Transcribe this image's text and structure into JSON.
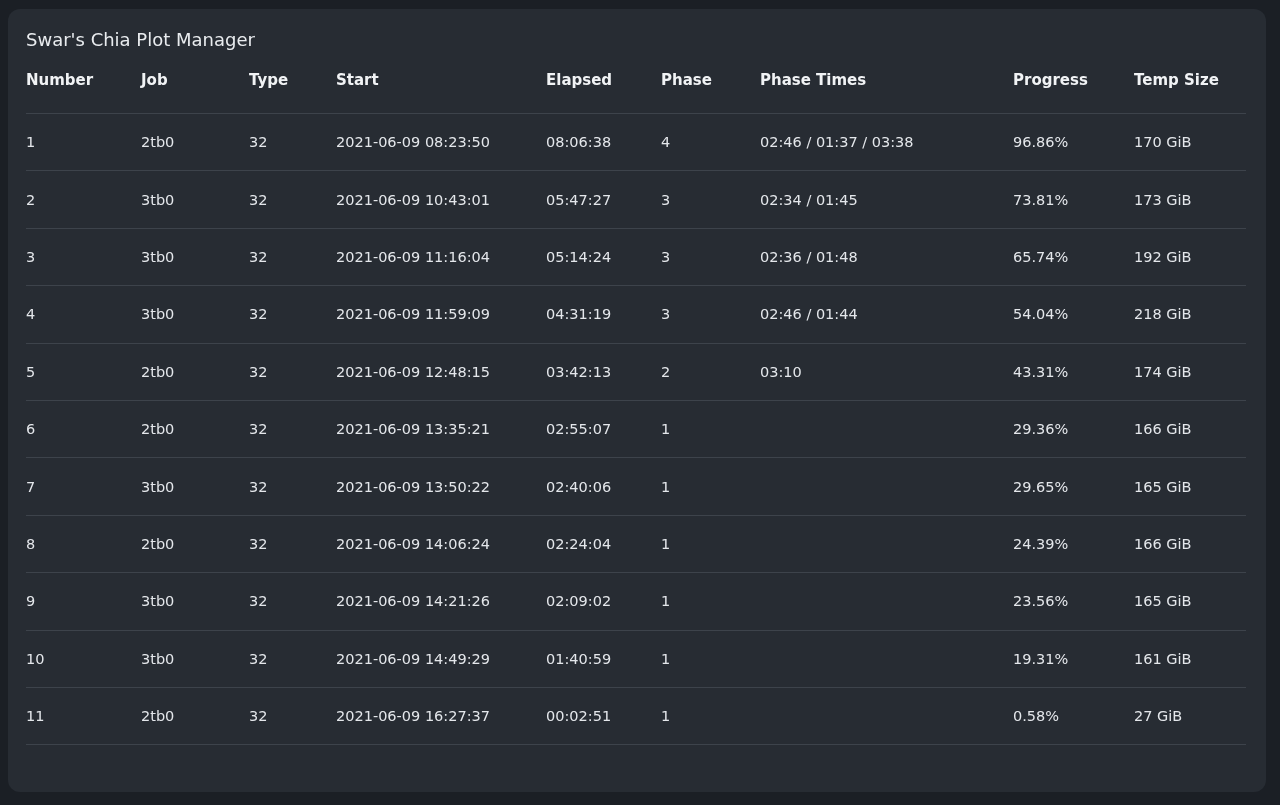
{
  "title": "Swar's Chia Plot Manager",
  "columns": [
    "Number",
    "Job",
    "Type",
    "Start",
    "Elapsed",
    "Phase",
    "Phase Times",
    "Progress",
    "Temp Size"
  ],
  "rows": [
    [
      "1",
      "2tb0",
      "32",
      "2021-06-09 08:23:50",
      "08:06:38",
      "4",
      "02:46 / 01:37 / 03:38",
      "96.86%",
      "170 GiB"
    ],
    [
      "2",
      "3tb0",
      "32",
      "2021-06-09 10:43:01",
      "05:47:27",
      "3",
      "02:34 / 01:45",
      "73.81%",
      "173 GiB"
    ],
    [
      "3",
      "3tb0",
      "32",
      "2021-06-09 11:16:04",
      "05:14:24",
      "3",
      "02:36 / 01:48",
      "65.74%",
      "192 GiB"
    ],
    [
      "4",
      "3tb0",
      "32",
      "2021-06-09 11:59:09",
      "04:31:19",
      "3",
      "02:46 / 01:44",
      "54.04%",
      "218 GiB"
    ],
    [
      "5",
      "2tb0",
      "32",
      "2021-06-09 12:48:15",
      "03:42:13",
      "2",
      "03:10",
      "43.31%",
      "174 GiB"
    ],
    [
      "6",
      "2tb0",
      "32",
      "2021-06-09 13:35:21",
      "02:55:07",
      "1",
      "",
      "29.36%",
      "166 GiB"
    ],
    [
      "7",
      "3tb0",
      "32",
      "2021-06-09 13:50:22",
      "02:40:06",
      "1",
      "",
      "29.65%",
      "165 GiB"
    ],
    [
      "8",
      "2tb0",
      "32",
      "2021-06-09 14:06:24",
      "02:24:04",
      "1",
      "",
      "24.39%",
      "166 GiB"
    ],
    [
      "9",
      "3tb0",
      "32",
      "2021-06-09 14:21:26",
      "02:09:02",
      "1",
      "",
      "23.56%",
      "165 GiB"
    ],
    [
      "10",
      "3tb0",
      "32",
      "2021-06-09 14:49:29",
      "01:40:59",
      "1",
      "",
      "19.31%",
      "161 GiB"
    ],
    [
      "11",
      "2tb0",
      "32",
      "2021-06-09 16:27:37",
      "00:02:51",
      "1",
      "",
      "0.58%",
      "27 GiB"
    ]
  ]
}
